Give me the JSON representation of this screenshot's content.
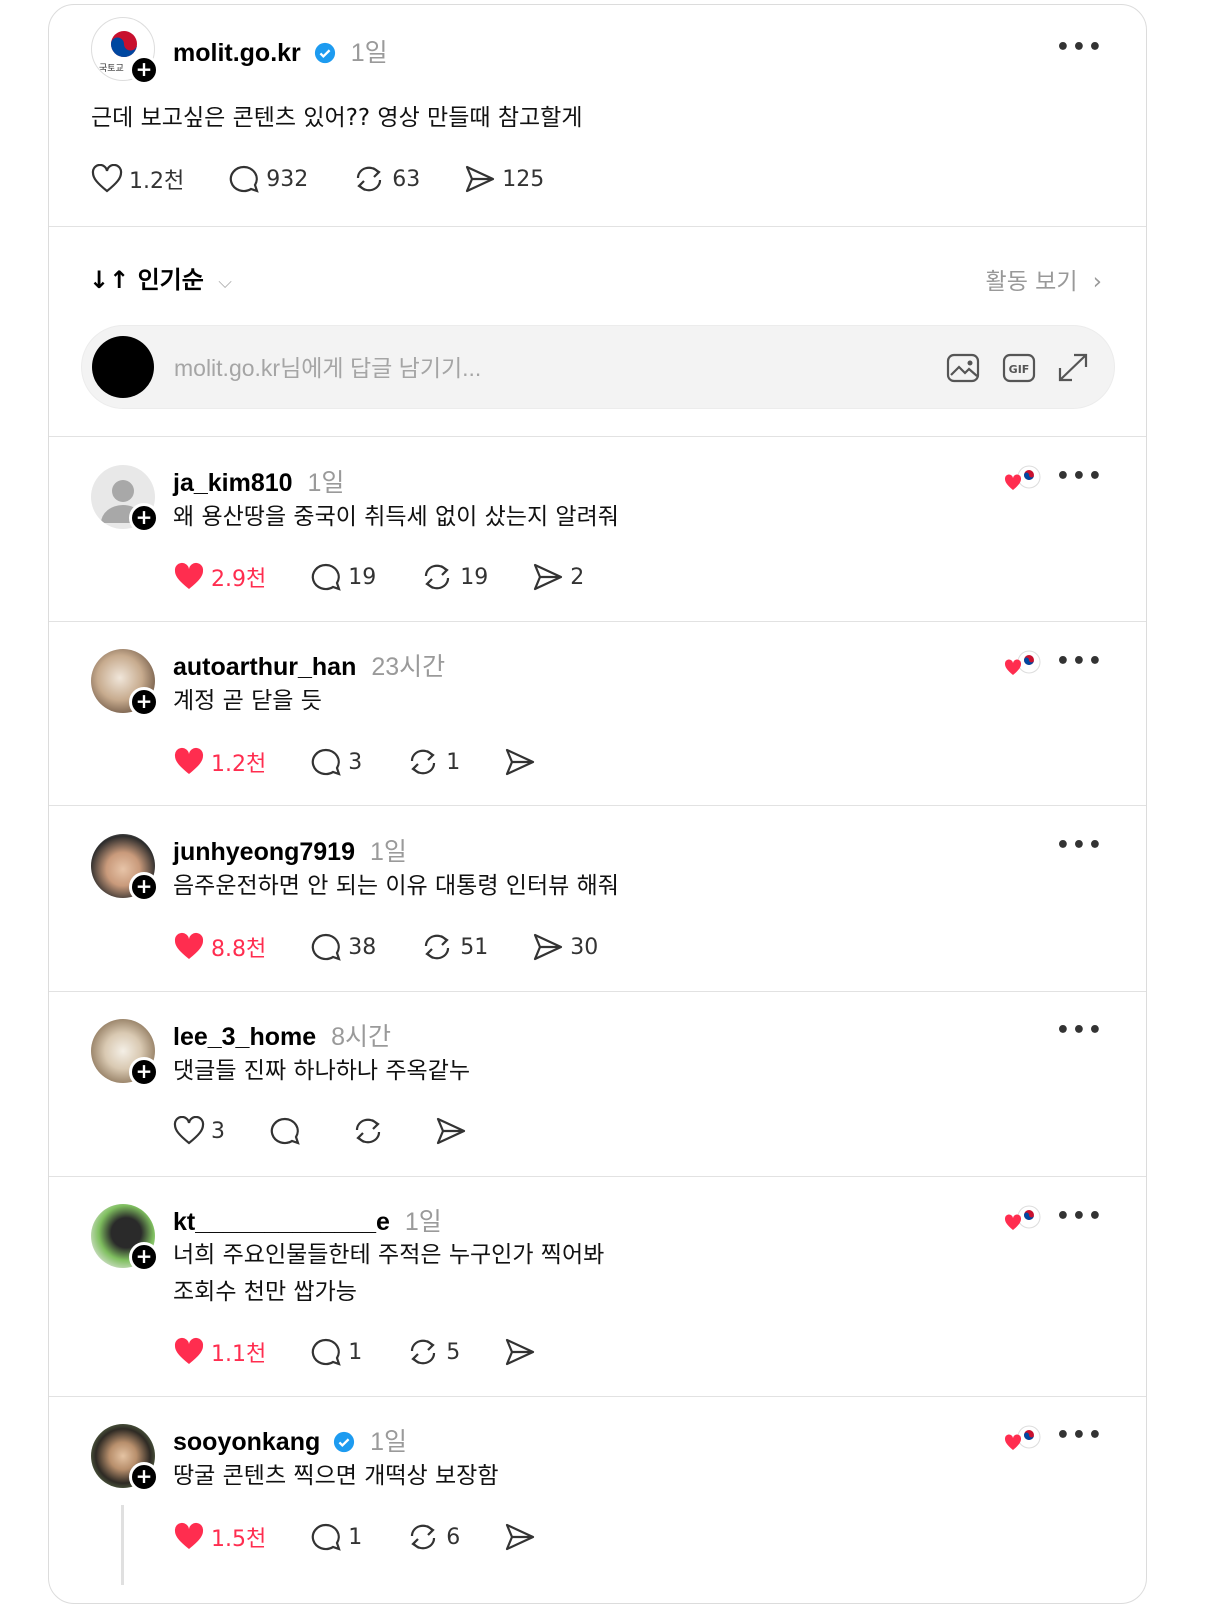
{
  "post": {
    "username": "molit.go.kr",
    "time": "1일",
    "verified": true,
    "avatar_label": "국토교",
    "text": "근데 보고싶은 콘텐츠 있어?? 영상 만들때 참고할게",
    "likes": "1.2천",
    "replies": "932",
    "reposts": "63",
    "shares": "125"
  },
  "toolbar": {
    "sort_label": "인기순",
    "activity_label": "활동 보기"
  },
  "composer": {
    "placeholder": "molit.go.kr님에게 답글 남기기..."
  },
  "replies": [
    {
      "username": "ja_kim810",
      "time": "1일",
      "text": "왜 용산땅을 중국이 취득세 없이 샀는지 알려줘",
      "likes": "2.9천",
      "replies": "19",
      "reposts": "19",
      "shares": "2",
      "liked": true,
      "author_liked": true
    },
    {
      "username": "autoarthur_han",
      "time": "23시간",
      "text": "계정 곧 닫을 듯",
      "likes": "1.2천",
      "replies": "3",
      "reposts": "1",
      "shares": "",
      "liked": true,
      "author_liked": true
    },
    {
      "username": "junhyeong7919",
      "time": "1일",
      "text": "음주운전하면 안 되는 이유 대통령 인터뷰 해줘",
      "likes": "8.8천",
      "replies": "38",
      "reposts": "51",
      "shares": "30",
      "liked": true,
      "author_liked": false
    },
    {
      "username": "lee_3_home",
      "time": "8시간",
      "text": "댓글들 진짜 하나하나 주옥같누",
      "likes": "3",
      "replies": "",
      "reposts": "",
      "shares": "",
      "liked": false,
      "author_liked": false
    },
    {
      "username": "kt_____________e",
      "time": "1일",
      "text": "너희 주요인물들한테 주적은 누구인가 찍어봐",
      "text2": "조회수 천만 쌉가능",
      "likes": "1.1천",
      "replies": "1",
      "reposts": "5",
      "shares": "",
      "liked": true,
      "author_liked": true
    },
    {
      "username": "sooyonkang",
      "time": "1일",
      "verified": true,
      "text": "땅굴 콘텐츠 찍으면 개떡상 보장함",
      "likes": "1.5천",
      "replies": "1",
      "reposts": "6",
      "shares": "",
      "liked": true,
      "author_liked": true
    }
  ],
  "colors": {
    "like_active": "#ff2d4f",
    "verified_blue": "#1d9bf0",
    "muted_text": "#9a9a9a"
  }
}
